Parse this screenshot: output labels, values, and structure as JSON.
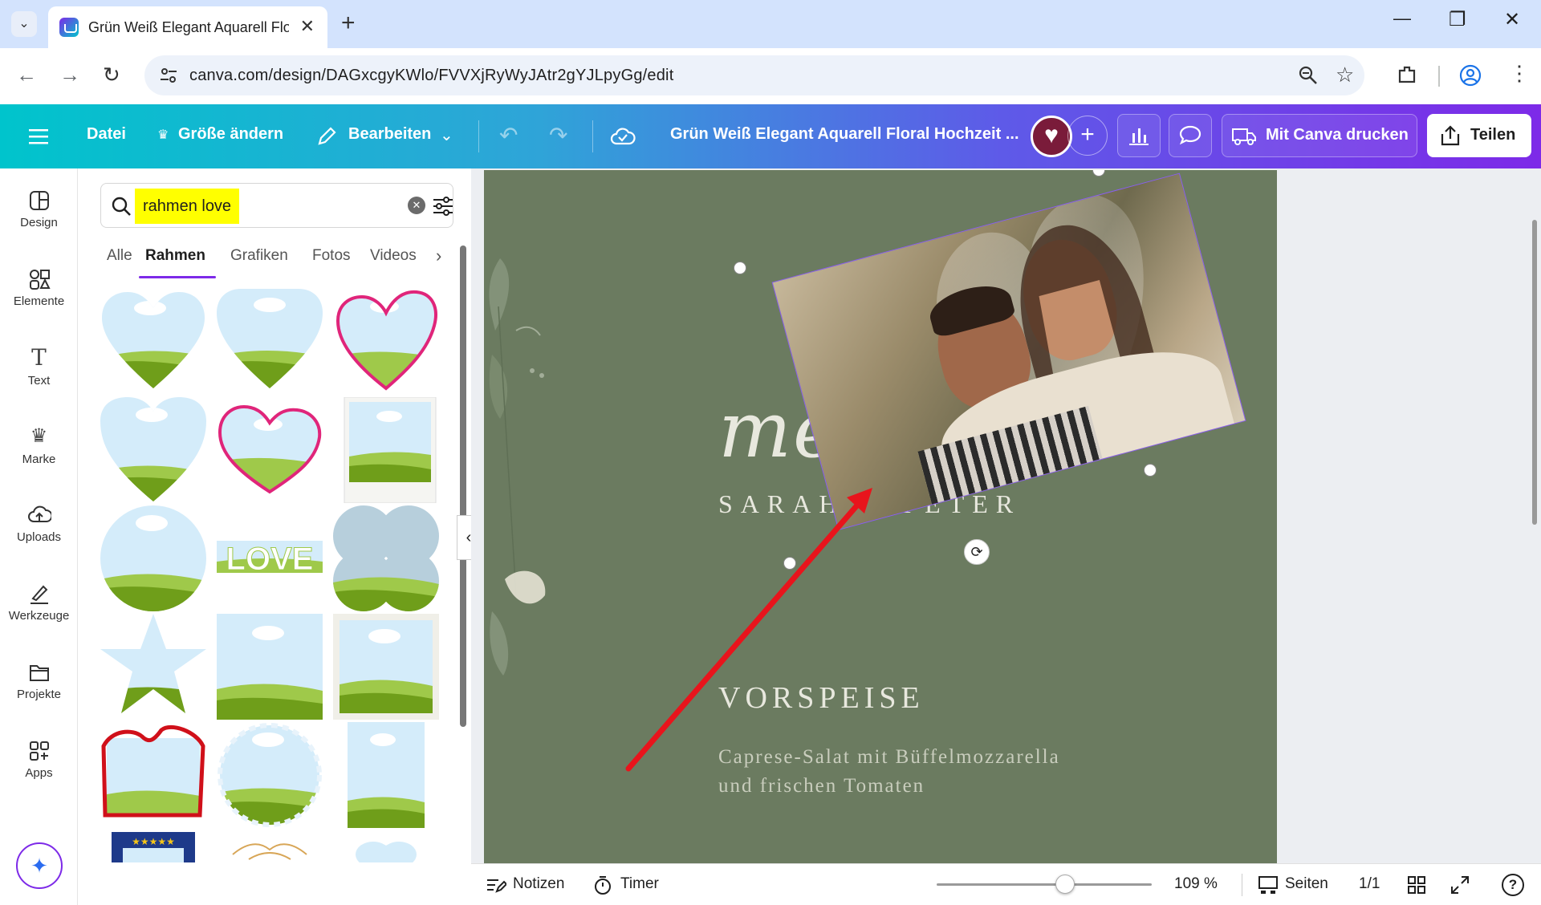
{
  "browser": {
    "tab_title": "Grün Weiß Elegant Aquarell Flo",
    "url": "canva.com/design/DAGxcgyKWlo/FVVXjRyWyJAtr2gYJLpyGg/edit",
    "new_tab": "+",
    "close": "✕",
    "minimize": "—",
    "restore": "❐",
    "win_close": "✕"
  },
  "toolbar": {
    "file": "Datei",
    "resize": "Größe ändern",
    "edit": "Bearbeiten",
    "doc_title": "Grün Weiß Elegant Aquarell Floral Hochzeit ...",
    "print": "Mit Canva drucken",
    "share": "Teilen",
    "plus": "+"
  },
  "sidebar": {
    "items": [
      {
        "label": "Design",
        "icon": "design-icon"
      },
      {
        "label": "Elemente",
        "icon": "elements-icon"
      },
      {
        "label": "Text",
        "icon": "text-icon"
      },
      {
        "label": "Marke",
        "icon": "brand-icon"
      },
      {
        "label": "Uploads",
        "icon": "upload-icon"
      },
      {
        "label": "Werkzeuge",
        "icon": "tools-icon"
      },
      {
        "label": "Projekte",
        "icon": "folder-icon"
      },
      {
        "label": "Apps",
        "icon": "apps-icon"
      }
    ]
  },
  "panel": {
    "search_value": "rahmen love",
    "tabs": [
      "Alle",
      "Rahmen",
      "Grafiken",
      "Fotos",
      "Videos"
    ],
    "active_tab": "Rahmen"
  },
  "design": {
    "script_title": "menü",
    "names": "SARAH & PETER",
    "section": "VORSPEISE",
    "dish_line1": "Caprese-Salat mit Büffelmozzarella",
    "dish_line2": "und frischen Tomaten"
  },
  "bottom": {
    "notes": "Notizen",
    "timer": "Timer",
    "zoom": "109 %",
    "zoom_level_percent": 109,
    "pages": "Seiten",
    "page_count": "1/1",
    "help": "?"
  },
  "colors": {
    "page_bg": "#6b7b60",
    "highlight": "#ffff00",
    "arrow": "#e8141c",
    "accent": "#7d2ae8"
  }
}
